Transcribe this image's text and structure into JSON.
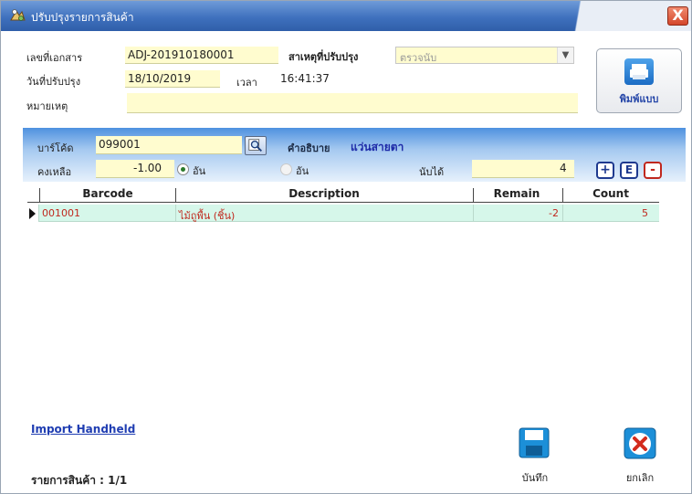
{
  "window": {
    "title": "ปรับปรุงรายการสินค้า",
    "close_label": "X"
  },
  "header": {
    "doc_no_label": "เลขที่เอกสาร",
    "doc_no_value": "ADJ-201910180001",
    "reason_label": "สาเหตุที่ปรับปรุง",
    "reason_value": "ตรวจนับ",
    "date_label": "วันที่ปรับปรุง",
    "date_value": "18/10/2019",
    "time_label": "เวลา",
    "time_value": "16:41:37",
    "note_label": "หมายเหตุ",
    "note_value": ""
  },
  "print_button": {
    "label": "พิมพ์แบบ"
  },
  "entry": {
    "barcode_label": "บาร์โค้ด",
    "barcode_value": "099001",
    "desc_label": "คำอธิบาย",
    "desc_value": "แว่นสายตา",
    "remain_label": "คงเหลือ",
    "remain_value": "-1.00",
    "unit_radio_1": "อัน",
    "unit_radio_2": "อัน",
    "counted_label": "นับได้",
    "counted_value": "4"
  },
  "grid_buttons": {
    "add": "+",
    "edit": "E",
    "remove": "-"
  },
  "table": {
    "columns": [
      "Barcode",
      "Description",
      "Remain",
      "Count"
    ],
    "rows": [
      {
        "barcode": "001001",
        "description": "ไม้ถูพื้น (ชิ้น)",
        "remain": "-2",
        "count": "5"
      }
    ]
  },
  "footer": {
    "import_link": "Import Handheld",
    "item_count": "รายการสินค้า : 1/1",
    "save_label": "บันทึก",
    "cancel_label": "ยกเลิก"
  },
  "colors": {
    "title_bar": "#3f71be",
    "field_bg": "#fffccf",
    "row_bg": "#d6f7ea",
    "row_text": "#c0281e",
    "link": "#1f3db2"
  }
}
